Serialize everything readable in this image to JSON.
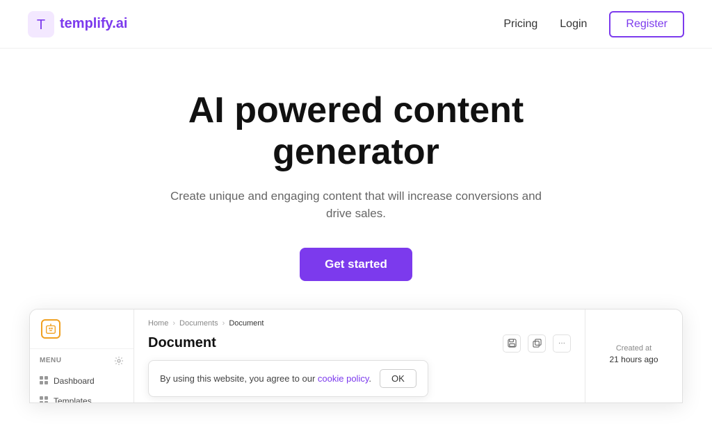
{
  "nav": {
    "logo_text": "templify.ai",
    "pricing_label": "Pricing",
    "login_label": "Login",
    "register_label": "Register"
  },
  "hero": {
    "title": "AI powered content generator",
    "subtitle": "Create unique and engaging content that will increase conversions and drive sales.",
    "cta_label": "Get started"
  },
  "preview": {
    "sidebar": {
      "menu_label": "MENU",
      "items": [
        {
          "label": "Dashboard"
        },
        {
          "label": "Templates"
        }
      ]
    },
    "breadcrumb": {
      "home": "Home",
      "documents": "Documents",
      "active": "Document"
    },
    "doc_title": "Document",
    "created_label": "Created at",
    "created_time": "21 hours ago"
  },
  "cookie": {
    "text": "By using this website, you agree to our ",
    "link_text": "cookie policy",
    "period": ".",
    "ok_label": "OK"
  },
  "icons": {
    "robot": "⚙",
    "gear": "⚙",
    "grid": "⊞",
    "save": "⬛",
    "copy": "❐",
    "more": "···",
    "chevron": "›"
  }
}
